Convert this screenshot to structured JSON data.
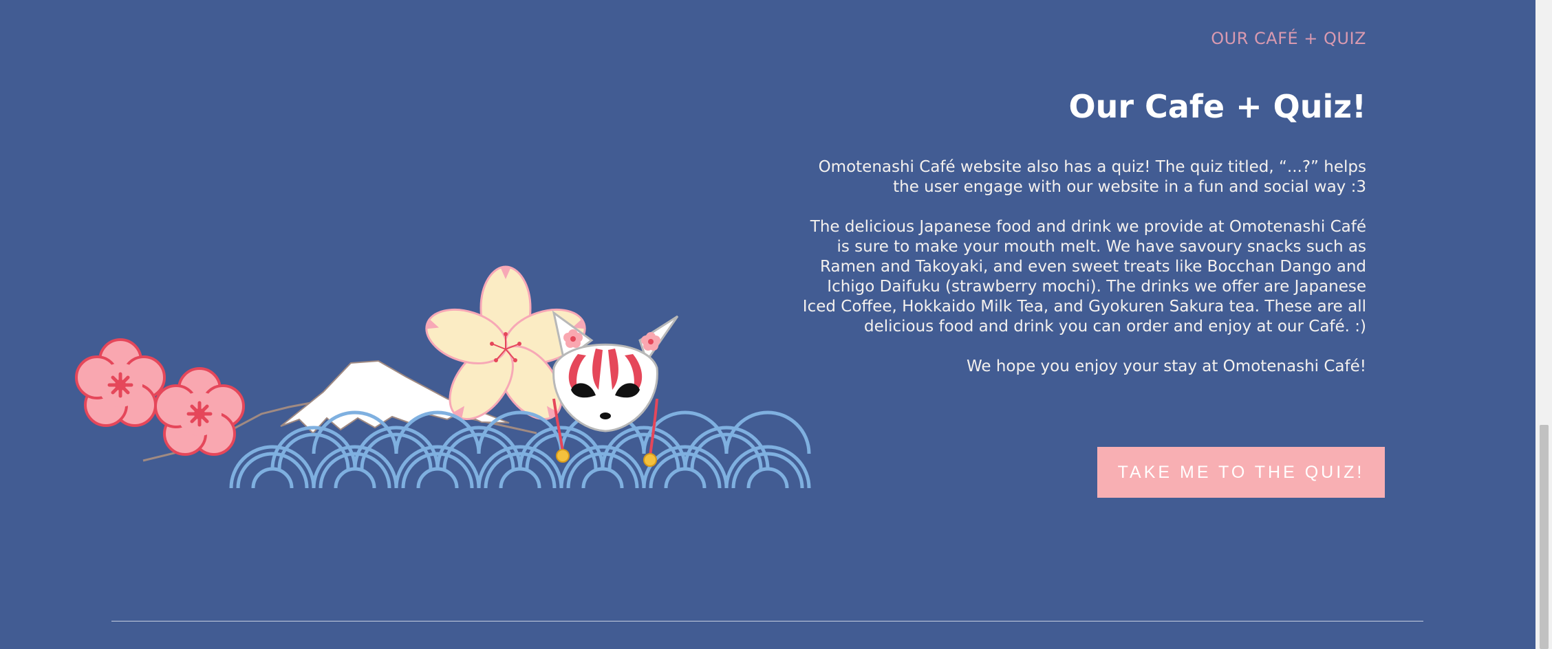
{
  "section": {
    "eyebrow": "OUR CAFÉ + QUIZ",
    "heading": "Our Cafe + Quiz!",
    "paragraphs": [
      "Omotenashi Café website also has a quiz! The quiz titled, “...?” helps the user engage with our website in a fun and social way :3",
      "The delicious Japanese food and drink we provide at Omotenashi Café is sure to make your mouth melt. We have savoury snacks such as Ramen and Takoyaki, and even sweet treats like Bocchan Dango and Ichigo Daifuku (strawberry mochi). The drinks we offer are Japanese Iced Coffee, Hokkaido Milk Tea, and Gyokuren Sakura tea. These are all delicious food and drink you can order and enjoy at our Café. :)",
      "We hope you enjoy your stay at Omotenashi Café!"
    ],
    "button_label": "TAKE ME TO THE QUIZ!"
  },
  "colors": {
    "background": "#425c93",
    "eyebrow": "#d99ab0",
    "button": "#f8afb3",
    "wave": "#7fb0e0",
    "plum_blossom": "#f9a7b0",
    "sakura": "#fbecc4"
  }
}
